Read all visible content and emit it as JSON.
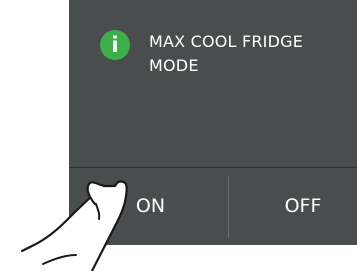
{
  "dialog": {
    "icon": "info-icon",
    "icon_glyph": "i",
    "message_line1": "MAX COOL FRIDGE",
    "message_line2": "MODE"
  },
  "buttons": {
    "on_label": "ON",
    "off_label": "OFF"
  },
  "colors": {
    "panel": "#4a4d4d",
    "icon_green": "#3dae49",
    "text": "#ffffff"
  },
  "illustration": {
    "pointer": "finger-hand-icon"
  }
}
